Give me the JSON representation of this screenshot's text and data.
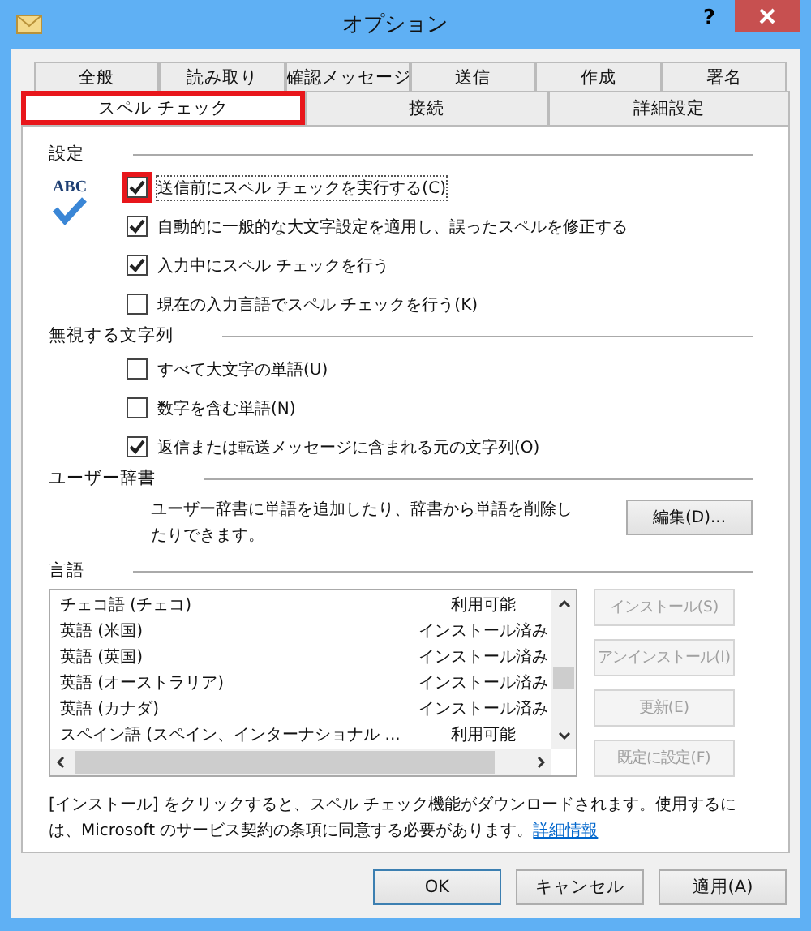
{
  "window": {
    "title": "オプション",
    "help": "?"
  },
  "tabs": [
    [
      {
        "label": "全般",
        "selected": false,
        "highlighted": false
      },
      {
        "label": "読み取り",
        "selected": false,
        "highlighted": false
      },
      {
        "label": "確認メッセージ",
        "selected": false,
        "highlighted": false
      },
      {
        "label": "送信",
        "selected": false,
        "highlighted": false
      },
      {
        "label": "作成",
        "selected": false,
        "highlighted": false
      },
      {
        "label": "署名",
        "selected": false,
        "highlighted": false
      }
    ],
    [
      {
        "label": "スペル チェック",
        "selected": true,
        "highlighted": true
      },
      {
        "label": "接続",
        "selected": false,
        "highlighted": false
      },
      {
        "label": "詳細設定",
        "selected": false,
        "highlighted": false
      }
    ]
  ],
  "settings": {
    "heading": "設定",
    "options": [
      {
        "label": "送信前にスペル チェックを実行する(C)",
        "checked": true,
        "highlighted": true
      },
      {
        "label": "自動的に一般的な大文字設定を適用し、誤ったスペルを修正する",
        "checked": true,
        "highlighted": false
      },
      {
        "label": "入力中にスペル チェックを行う",
        "checked": true,
        "highlighted": false
      },
      {
        "label": "現在の入力言語でスペル チェックを行う(K)",
        "checked": false,
        "highlighted": false
      }
    ],
    "icon_text": "ABC"
  },
  "ignore": {
    "heading": "無視する文字列",
    "options": [
      {
        "label": "すべて大文字の単語(U)",
        "checked": false,
        "highlighted": false
      },
      {
        "label": "数字を含む単語(N)",
        "checked": false,
        "highlighted": false
      },
      {
        "label": "返信または転送メッセージに含まれる元の文字列(O)",
        "checked": true,
        "highlighted": false
      }
    ]
  },
  "user_dictionary": {
    "heading": "ユーザー辞書",
    "description": "ユーザー辞書に単語を追加したり、辞書から単語を削除したりできます。",
    "button": {
      "label": "編集(D)..."
    }
  },
  "languages": {
    "heading": "言語",
    "rows": [
      {
        "name": "チェコ語 (チェコ)",
        "status": "利用可能"
      },
      {
        "name": "英語 (米国)",
        "status": "インストール済み"
      },
      {
        "name": "英語 (英国)",
        "status": "インストール済み"
      },
      {
        "name": "英語 (オーストラリア)",
        "status": "インストール済み"
      },
      {
        "name": "英語 (カナダ)",
        "status": "インストール済み"
      },
      {
        "name": "スペイン語 (スペイン、インターナショナル ...",
        "status": "利用可能"
      }
    ],
    "buttons": [
      {
        "label": "インストール(S)",
        "disabled": true
      },
      {
        "label": "アンインストール(I)",
        "disabled": true
      },
      {
        "label": "更新(E)",
        "disabled": true
      },
      {
        "label": "既定に設定(F)",
        "disabled": true
      }
    ]
  },
  "footer": {
    "text": "[インストール] をクリックすると、スペル チェック機能がダウンロードされます。使用するには、Microsoft のサービス契約の条項に同意する必要があります。",
    "link": "詳細情報"
  },
  "buttons": [
    {
      "label": "OK",
      "default": true
    },
    {
      "label": "キャンセル",
      "default": false
    },
    {
      "label": "適用(A)",
      "default": false
    }
  ]
}
